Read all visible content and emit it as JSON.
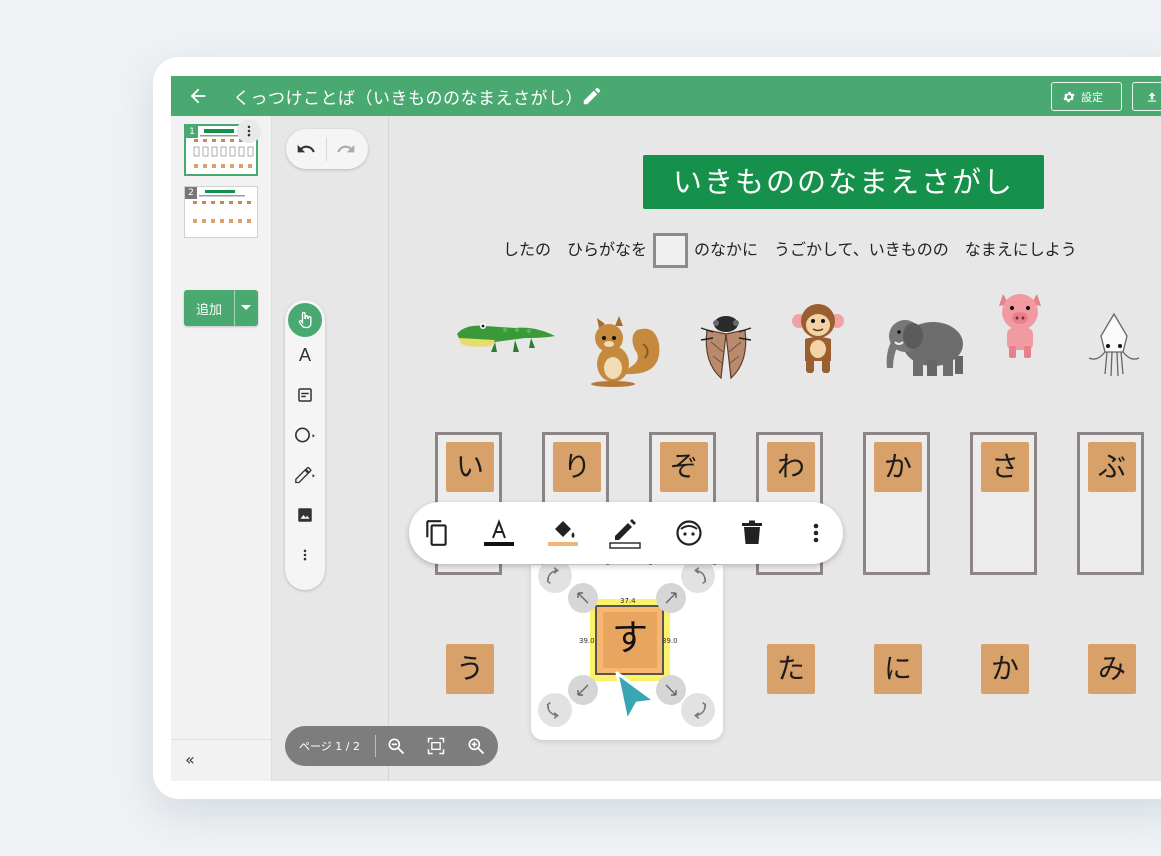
{
  "header": {
    "title": "くっつけことば（いきもののなまえさがし）",
    "settings_label": "設定"
  },
  "pages": {
    "thumbs": [
      {
        "num": "1",
        "active": true
      },
      {
        "num": "2",
        "active": false
      }
    ],
    "add_label": "追加"
  },
  "page_indicator": {
    "label": "ページ 1 / 2"
  },
  "worksheet": {
    "title": "いきもののなまえさがし",
    "instruction_before": "したの　ひらがなを",
    "instruction_after": "のなかに　うごかして、いきものの　なまえにしよう",
    "animals": [
      "crocodile",
      "squirrel",
      "cicada",
      "monkey",
      "elephant",
      "pig",
      "squid"
    ],
    "slot_tiles": [
      "い",
      "り",
      "ぞ",
      "わ",
      "か",
      "さ",
      "ぶ"
    ],
    "bottom_tiles": [
      "う",
      "た",
      "に",
      "か",
      "み"
    ],
    "selected_tile": "す",
    "selection_width": "37.4",
    "selection_height_left": "39.0",
    "selection_height_right": "39.0"
  },
  "colors": {
    "header": "#4aa971",
    "title_bg": "#16914b",
    "tile": "#d9a16a",
    "cursor": "#3aa6b3"
  },
  "icons": {
    "header": [
      "back-arrow-icon",
      "pencil-icon",
      "gear-icon",
      "upload-icon"
    ],
    "tools": [
      "pointer-hand-icon",
      "text-a-icon",
      "textbox-icon",
      "shape-circle-icon",
      "pen-icon",
      "image-icon",
      "more-vertical-icon"
    ],
    "context": [
      "duplicate-icon",
      "text-color-icon",
      "fill-color-icon",
      "border-color-icon",
      "emoji-face-icon",
      "trash-icon",
      "more-vertical-icon"
    ]
  }
}
